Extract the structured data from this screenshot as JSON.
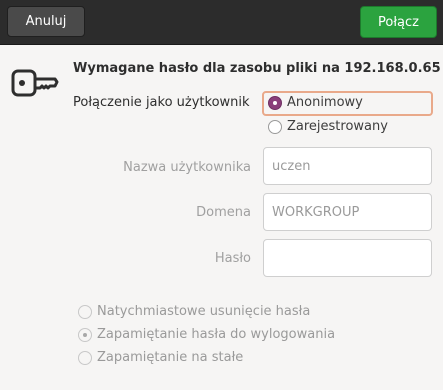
{
  "header": {
    "cancel_label": "Anuluj",
    "connect_label": "Połącz"
  },
  "dialog": {
    "heading": "Wymagane hasło dla zasobu pliki na 192.168.0.65",
    "connection_label": "Połączenie jako użytkownik",
    "connection_options": [
      {
        "label": "Anonimowy",
        "selected": true
      },
      {
        "label": "Zarejestrowany",
        "selected": false
      }
    ],
    "fields": {
      "username_label": "Nazwa użytkownika",
      "username_value": "uczen",
      "domain_label": "Domena",
      "domain_value": "WORKGROUP",
      "password_label": "Hasło",
      "password_value": ""
    },
    "remember_options": [
      {
        "label": "Natychmiastowe usunięcie hasła",
        "selected": false
      },
      {
        "label": "Zapamiętanie hasła do wylogowania",
        "selected": true
      },
      {
        "label": "Zapamiętanie na stałe",
        "selected": false
      }
    ]
  },
  "colors": {
    "header_bg": "#2c2c2c",
    "connect_button": "#2ba33f",
    "radio_selected": "#8a3e7a",
    "focus_outline": "#e9a98a"
  }
}
